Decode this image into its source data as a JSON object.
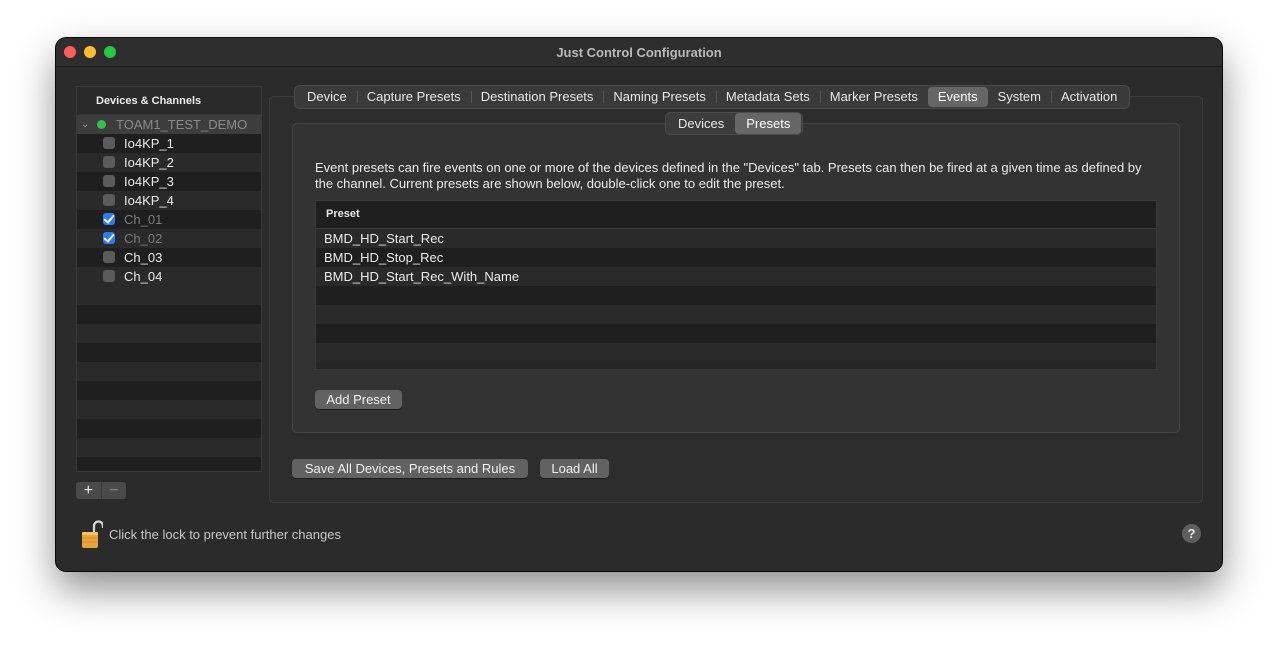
{
  "window": {
    "title": "Just Control Configuration"
  },
  "sidebar": {
    "header": "Devices & Channels",
    "root": {
      "label": "TOAM1_TEST_DEMO",
      "status_color": "#30c24a"
    },
    "children": [
      {
        "label": "Io4KP_1",
        "checked": false,
        "dim": false
      },
      {
        "label": "Io4KP_2",
        "checked": false,
        "dim": false
      },
      {
        "label": "Io4KP_3",
        "checked": false,
        "dim": false
      },
      {
        "label": "Io4KP_4",
        "checked": false,
        "dim": false
      },
      {
        "label": "Ch_01",
        "checked": true,
        "dim": true
      },
      {
        "label": "Ch_02",
        "checked": true,
        "dim": true
      },
      {
        "label": "Ch_03",
        "checked": false,
        "dim": false
      },
      {
        "label": "Ch_04",
        "checked": false,
        "dim": false
      }
    ],
    "add_label": "+",
    "remove_label": "−"
  },
  "tabs": [
    {
      "label": "Device",
      "active": false
    },
    {
      "label": "Capture Presets",
      "active": false
    },
    {
      "label": "Destination Presets",
      "active": false
    },
    {
      "label": "Naming Presets",
      "active": false
    },
    {
      "label": "Metadata Sets",
      "active": false
    },
    {
      "label": "Marker Presets",
      "active": false
    },
    {
      "label": "Events",
      "active": true
    },
    {
      "label": "System",
      "active": false
    },
    {
      "label": "Activation",
      "active": false
    }
  ],
  "subtabs": [
    {
      "label": "Devices",
      "active": false
    },
    {
      "label": "Presets",
      "active": true
    }
  ],
  "events": {
    "description": "Event presets can fire events on one or more of the devices defined in the \"Devices\" tab. Presets can then be fired at a given time as defined by the channel. Current presets are shown below, double-click one to edit the preset.",
    "table_header": "Preset",
    "presets": [
      "BMD_HD_Start_Rec",
      "BMD_HD_Stop_Rec",
      "BMD_HD_Start_Rec_With_Name"
    ],
    "add_preset_label": "Add Preset"
  },
  "footer": {
    "save_all_label": "Save All Devices, Presets and Rules",
    "load_all_label": "Load All",
    "lock_text": "Click the lock to prevent further changes",
    "help_label": "?"
  },
  "colors": {
    "accent": "#2e7cf6",
    "lock": "#e8a43a"
  }
}
